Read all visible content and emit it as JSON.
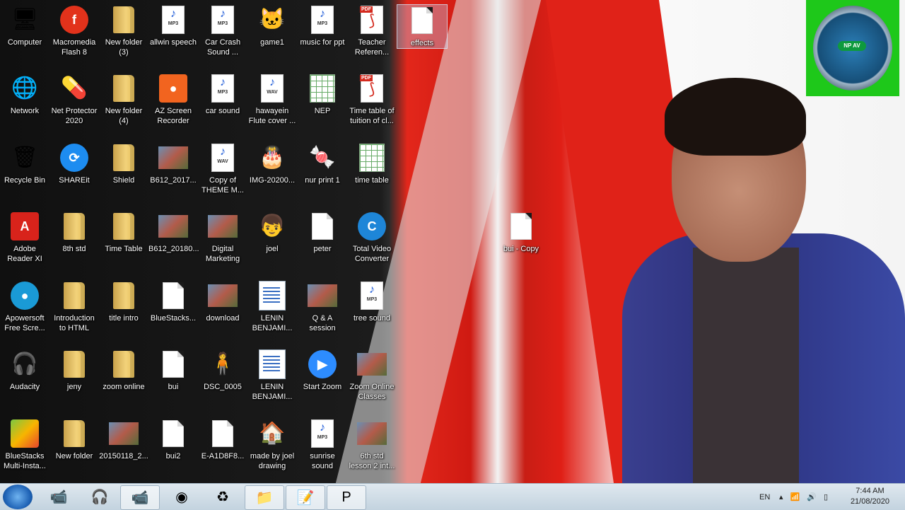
{
  "desktop": {
    "icons": [
      {
        "label": "Computer",
        "glyph": "🖥",
        "kind": "sys"
      },
      {
        "label": "Macromedia\nFlash 8",
        "glyph": "f",
        "kind": "flash"
      },
      {
        "label": "New folder\n(3)",
        "kind": "folder"
      },
      {
        "label": "allwin speech",
        "kind": "mp3"
      },
      {
        "label": "Car Crash\nSound ...",
        "kind": "mp3"
      },
      {
        "label": "game1",
        "glyph": "🐱",
        "kind": "app"
      },
      {
        "label": "music for ppt",
        "kind": "mp3"
      },
      {
        "label": "Teacher\nReferen...",
        "kind": "pdf"
      },
      {
        "label": "effects",
        "kind": "file",
        "selected": true
      },
      {
        "label": "Network",
        "glyph": "🌐",
        "kind": "sys"
      },
      {
        "label": "Net Protector\n2020",
        "glyph": "💊",
        "kind": "app"
      },
      {
        "label": "New folder\n(4)",
        "kind": "folder"
      },
      {
        "label": "AZ Screen\nRecorder",
        "glyph": "📹",
        "kind": "azrec"
      },
      {
        "label": "car sound",
        "kind": "mp3"
      },
      {
        "label": "hawayein\nFlute cover ...",
        "kind": "wav"
      },
      {
        "label": "NEP",
        "kind": "xls"
      },
      {
        "label": "Time table of\ntuition of cl...",
        "kind": "pdf"
      },
      {
        "label": "Recycle Bin",
        "glyph": "🗑",
        "kind": "sys"
      },
      {
        "label": "SHAREit",
        "kind": "shareit"
      },
      {
        "label": "Shield",
        "kind": "folder"
      },
      {
        "label": "B612_2017...",
        "kind": "thumb"
      },
      {
        "label": "Copy of\nTHEME M...",
        "kind": "wav"
      },
      {
        "label": "IMG-20200...",
        "glyph": "🎂",
        "kind": "app"
      },
      {
        "label": "nur print 1",
        "glyph": "🍬",
        "kind": "app"
      },
      {
        "label": "time table",
        "kind": "xls"
      },
      {
        "label": "Adobe\nReader XI",
        "kind": "adobe"
      },
      {
        "label": "8th std",
        "kind": "folder"
      },
      {
        "label": "Time Table",
        "kind": "folder"
      },
      {
        "label": "B612_20180...",
        "kind": "thumb"
      },
      {
        "label": "Digital\nMarketing",
        "kind": "thumb"
      },
      {
        "label": "joel",
        "glyph": "👦",
        "kind": "app"
      },
      {
        "label": "peter",
        "kind": "file"
      },
      {
        "label": "Total Video\nConverter",
        "kind": "tvc"
      },
      {
        "label": "bui - Copy",
        "kind": "file"
      },
      {
        "label": "Apowersoft\nFree Scre...",
        "kind": "apower"
      },
      {
        "label": "Introduction\nto HTML",
        "kind": "folder"
      },
      {
        "label": "title intro",
        "kind": "folder"
      },
      {
        "label": "BlueStacks...",
        "kind": "file"
      },
      {
        "label": "download",
        "kind": "thumb"
      },
      {
        "label": "LENIN\nBENJAMI...",
        "kind": "doc"
      },
      {
        "label": "Q & A\nsession",
        "kind": "thumb"
      },
      {
        "label": "tree sound",
        "kind": "mp3"
      },
      {
        "label": "Audacity",
        "glyph": "🎧",
        "kind": "app"
      },
      {
        "label": "jeny",
        "kind": "folder"
      },
      {
        "label": "zoom online",
        "kind": "folder"
      },
      {
        "label": "bui",
        "kind": "file"
      },
      {
        "label": "DSC_0005",
        "glyph": "🧍",
        "kind": "app"
      },
      {
        "label": "LENIN\nBENJAMI...",
        "kind": "doc"
      },
      {
        "label": "Start Zoom",
        "kind": "zoom"
      },
      {
        "label": "Zoom Online\nClasses",
        "kind": "thumb"
      },
      {
        "label": "BlueStacks\nMulti-Insta...",
        "kind": "bluestacks"
      },
      {
        "label": "New folder",
        "kind": "folder"
      },
      {
        "label": "20150118_2...",
        "kind": "thumb"
      },
      {
        "label": "bui2",
        "kind": "file"
      },
      {
        "label": "E-A1D8F8...",
        "kind": "file"
      },
      {
        "label": "made by joel\ndrawing",
        "glyph": "🏠",
        "kind": "app"
      },
      {
        "label": "sunrise\nsound",
        "kind": "mp3"
      },
      {
        "label": "6th std\nlesson 2 int...",
        "kind": "thumb"
      }
    ],
    "widget": {
      "badge": "NP AV"
    }
  },
  "taskbar": {
    "apps": [
      {
        "name": "screen-recorder",
        "glyph": "📹",
        "active": false
      },
      {
        "name": "headphones",
        "glyph": "🎧",
        "active": false
      },
      {
        "name": "zoom",
        "glyph": "📹",
        "active": true
      },
      {
        "name": "chrome",
        "glyph": "◉",
        "active": false
      },
      {
        "name": "shareit",
        "glyph": "♻",
        "active": false
      },
      {
        "name": "explorer",
        "glyph": "📁",
        "active": true
      },
      {
        "name": "notepad",
        "glyph": "📝",
        "active": true
      },
      {
        "name": "powerpoint",
        "glyph": "P",
        "active": true
      }
    ],
    "language": "EN",
    "time": "7:44 AM",
    "date": "21/08/2020"
  },
  "colors": {
    "accent_red": "#e3271b",
    "widget_green": "#1ec81a",
    "taskbar": "#c3d3df"
  }
}
